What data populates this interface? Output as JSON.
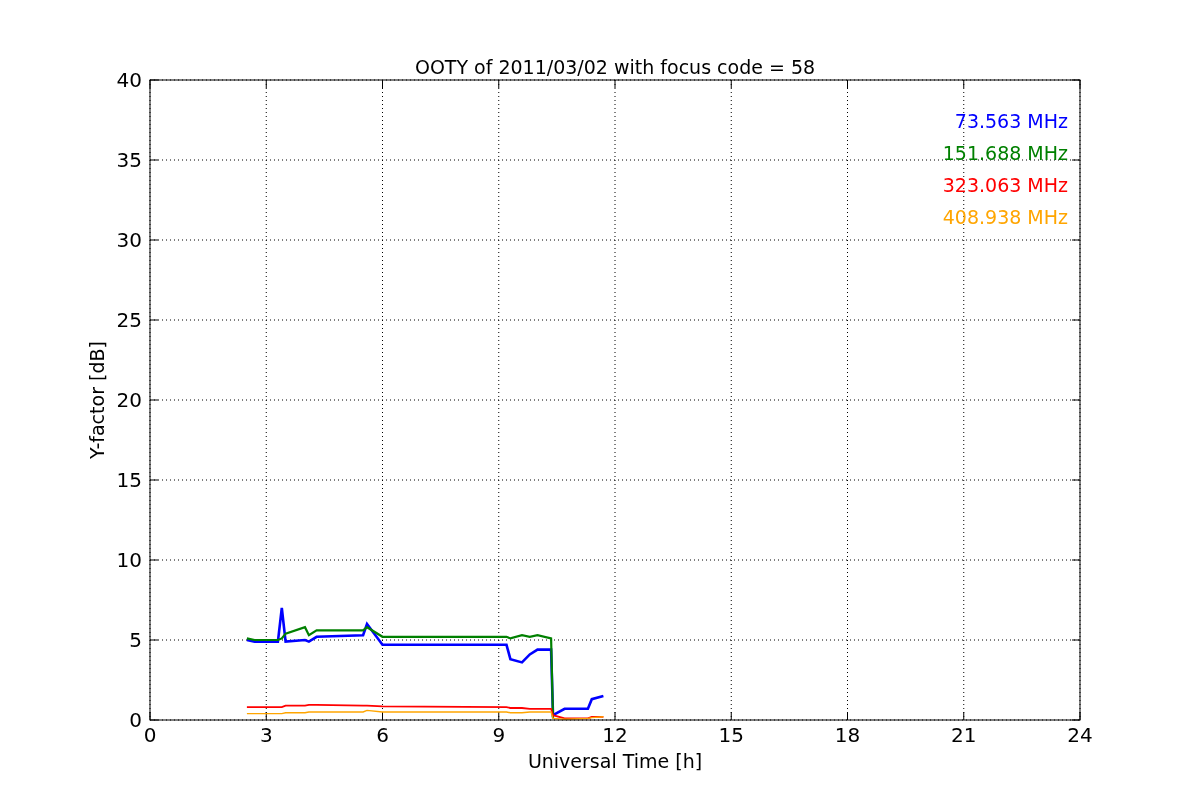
{
  "chart_data": {
    "type": "line",
    "title": "OOTY of 2011/03/02 with focus code = 58",
    "xlabel": "Universal Time [h]",
    "ylabel": "Y-factor [dB]",
    "x": [
      2.5,
      2.7,
      3.3,
      3.4,
      3.5,
      4.0,
      4.1,
      4.3,
      5.5,
      5.6,
      6.0,
      9.2,
      9.3,
      9.6,
      9.8,
      10.0,
      10.35,
      10.4,
      10.7,
      11.3,
      11.4,
      11.7
    ],
    "series": [
      {
        "name": "73.563 MHz",
        "color": "#0000ff",
        "values": [
          5.0,
          4.9,
          4.9,
          7.0,
          4.9,
          5.0,
          4.9,
          5.2,
          5.3,
          6.0,
          4.7,
          4.7,
          3.8,
          3.6,
          4.1,
          4.4,
          4.4,
          0.3,
          0.7,
          0.7,
          1.3,
          1.5
        ]
      },
      {
        "name": "151.688 MHz",
        "color": "#008000",
        "values": [
          5.1,
          5.0,
          5.0,
          5.1,
          5.4,
          5.8,
          5.3,
          5.6,
          5.6,
          5.8,
          5.2,
          5.2,
          5.1,
          5.3,
          5.2,
          5.3,
          5.1,
          0.1,
          null,
          null,
          null,
          null
        ]
      },
      {
        "name": "323.063 MHz",
        "color": "#ff0000",
        "values": [
          0.8,
          0.8,
          0.8,
          0.8,
          0.9,
          0.9,
          0.95,
          0.95,
          0.9,
          0.9,
          0.85,
          0.8,
          0.75,
          0.75,
          0.7,
          0.7,
          0.7,
          0.3,
          0.1,
          0.1,
          0.2,
          0.2
        ]
      },
      {
        "name": "408.938 MHz",
        "color": "#ffa500",
        "values": [
          0.4,
          0.4,
          0.4,
          0.4,
          0.45,
          0.45,
          0.5,
          0.5,
          0.5,
          0.6,
          0.5,
          0.5,
          0.45,
          0.45,
          0.5,
          0.5,
          0.5,
          0.1,
          0.05,
          0.1,
          0.15,
          0.2
        ]
      }
    ],
    "grid": true,
    "xlim": [
      0,
      24
    ],
    "ylim": [
      0,
      40
    ],
    "xticks": [
      0,
      3,
      6,
      9,
      12,
      15,
      18,
      21,
      24
    ],
    "yticks": [
      0,
      5,
      10,
      15,
      20,
      25,
      30,
      35,
      40
    ]
  }
}
